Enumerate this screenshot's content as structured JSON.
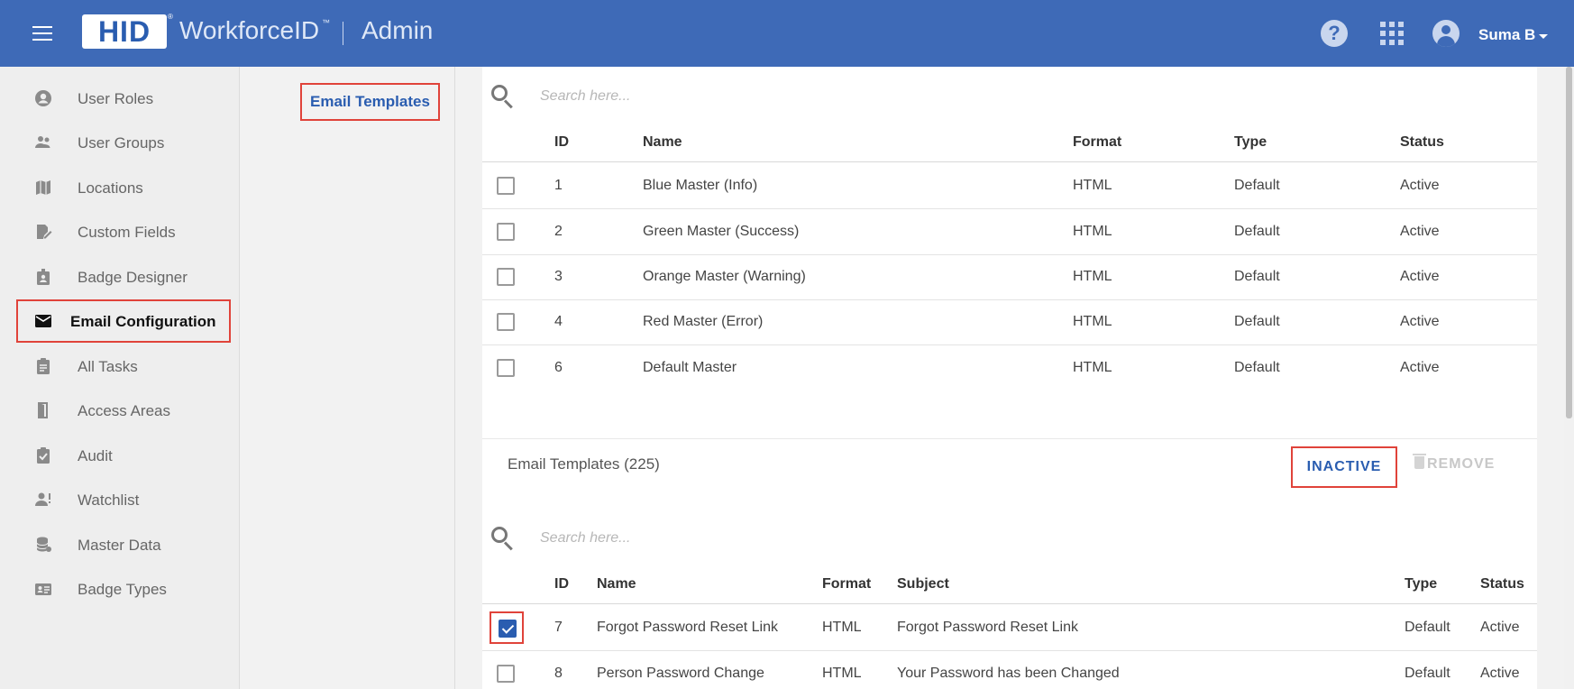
{
  "header": {
    "logo_text": "HID",
    "logo_reg": "®",
    "brand": "WorkforceID",
    "brand_tm": "™",
    "section": "Admin",
    "user": "Suma B"
  },
  "sidebar": {
    "items": [
      {
        "label": "User Roles",
        "icon": "account-circle-icon"
      },
      {
        "label": "User Groups",
        "icon": "people-icon"
      },
      {
        "label": "Locations",
        "icon": "map-icon"
      },
      {
        "label": "Custom Fields",
        "icon": "edit-note-icon"
      },
      {
        "label": "Badge Designer",
        "icon": "badge-icon"
      },
      {
        "label": "Email Configuration",
        "icon": "email-icon",
        "active": true
      },
      {
        "label": "All Tasks",
        "icon": "assignment-icon"
      },
      {
        "label": "Access Areas",
        "icon": "door-icon"
      },
      {
        "label": "Audit",
        "icon": "assignment-check-icon"
      },
      {
        "label": "Watchlist",
        "icon": "person-alert-icon"
      },
      {
        "label": "Master Data",
        "icon": "database-icon"
      },
      {
        "label": "Badge Types",
        "icon": "id-card-icon"
      }
    ]
  },
  "subnav": {
    "active": "Email Templates"
  },
  "masters_table": {
    "search_placeholder": "Search here...",
    "columns": {
      "id": "ID",
      "name": "Name",
      "format": "Format",
      "type": "Type",
      "status": "Status"
    },
    "rows": [
      {
        "id": "1",
        "name": "Blue Master (Info)",
        "format": "HTML",
        "type": "Default",
        "status": "Active"
      },
      {
        "id": "2",
        "name": "Green Master (Success)",
        "format": "HTML",
        "type": "Default",
        "status": "Active"
      },
      {
        "id": "3",
        "name": "Orange Master (Warning)",
        "format": "HTML",
        "type": "Default",
        "status": "Active"
      },
      {
        "id": "4",
        "name": "Red Master (Error)",
        "format": "HTML",
        "type": "Default",
        "status": "Active"
      },
      {
        "id": "6",
        "name": "Default Master",
        "format": "HTML",
        "type": "Default",
        "status": "Active"
      }
    ]
  },
  "templates": {
    "title": "Email Templates (225)",
    "inactive_label": "INACTIVE",
    "remove_label": "REMOVE",
    "search_placeholder": "Search here...",
    "columns": {
      "id": "ID",
      "name": "Name",
      "format": "Format",
      "subject": "Subject",
      "type": "Type",
      "status": "Status"
    },
    "rows": [
      {
        "id": "7",
        "name": "Forgot Password Reset Link",
        "format": "HTML",
        "subject": "Forgot Password Reset Link",
        "type": "Default",
        "status": "Active",
        "checked": true
      },
      {
        "id": "8",
        "name": "Person Password Change",
        "format": "HTML",
        "subject": "Your Password has been Changed",
        "type": "Default",
        "status": "Active",
        "checked": false
      }
    ]
  },
  "colors": {
    "header_bg": "#3e6ab7",
    "accent": "#2a5db0",
    "highlight": "#e0433a"
  }
}
